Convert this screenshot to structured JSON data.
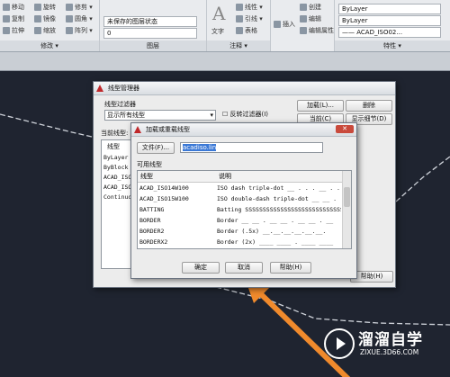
{
  "ribbon": {
    "panels": [
      {
        "title": "修改 ▾",
        "items": [
          "移动",
          "旋转",
          "修剪 ▾",
          "复制",
          "镜像",
          "圆角 ▾",
          "拉伸",
          "缩放",
          "阵列 ▾"
        ]
      },
      {
        "title": "图层",
        "items": [
          "未保存的图层状态",
          "0"
        ]
      },
      {
        "title": "注释 ▾",
        "big": "文字",
        "items": [
          "线性 ▾",
          "引线 ▾",
          "表格"
        ]
      },
      {
        "title": "",
        "items": [
          "插入",
          "创建",
          "编辑",
          "编辑属性"
        ]
      },
      {
        "title": "特性 ▾",
        "items": [
          "ByLayer",
          "ByLayer",
          "—— ACAD_ISO02..."
        ]
      }
    ]
  },
  "linetype_manager": {
    "title": "线型管理器",
    "filter_label": "线型过滤器",
    "filter_value": "显示所有线型",
    "invert_label": "反转过滤器(I)",
    "current_label": "当前线型:",
    "buttons": {
      "load": "加载(L)...",
      "delete": "删除",
      "current": "当前(C)",
      "details": "显示细节(D)",
      "help": "帮助(H)"
    },
    "list_header": "线型",
    "list_items": [
      "ByLayer",
      "ByBlock",
      "ACAD_ISO0...",
      "ACAD_ISO0...",
      "Continuous"
    ]
  },
  "load_dialog": {
    "title": "加载或重载线型",
    "file_button": "文件(F)...",
    "file_value": "acadiso.lin",
    "available_label": "可用线型",
    "col_linetype": "线型",
    "col_desc": "说明",
    "rows": [
      {
        "name": "ACAD_ISO14W100",
        "desc": "ISO dash triple-dot __ . . . __ . . ."
      },
      {
        "name": "ACAD_ISO15W100",
        "desc": "ISO double-dash triple-dot __ __ . . ."
      },
      {
        "name": "BATTING",
        "desc": "Batting SSSSSSSSSSSSSSSSSSSSSSSSSSSS"
      },
      {
        "name": "BORDER",
        "desc": "Border __ __ . __ __ . __ __ . __"
      },
      {
        "name": "BORDER2",
        "desc": "Border (.5x) __.__.__.__.__.__."
      },
      {
        "name": "BORDERX2",
        "desc": "Border (2x) ____ ____ . ____ ____"
      }
    ],
    "ok": "确定",
    "cancel": "取消",
    "help": "帮助(H)"
  },
  "watermark": {
    "name": "溜溜自学",
    "url": "ZIXUE.3D66.COM"
  },
  "colors": {
    "canvas": "#1f2430",
    "arrow": "#f08a2c",
    "accent": "#c94a3c"
  }
}
